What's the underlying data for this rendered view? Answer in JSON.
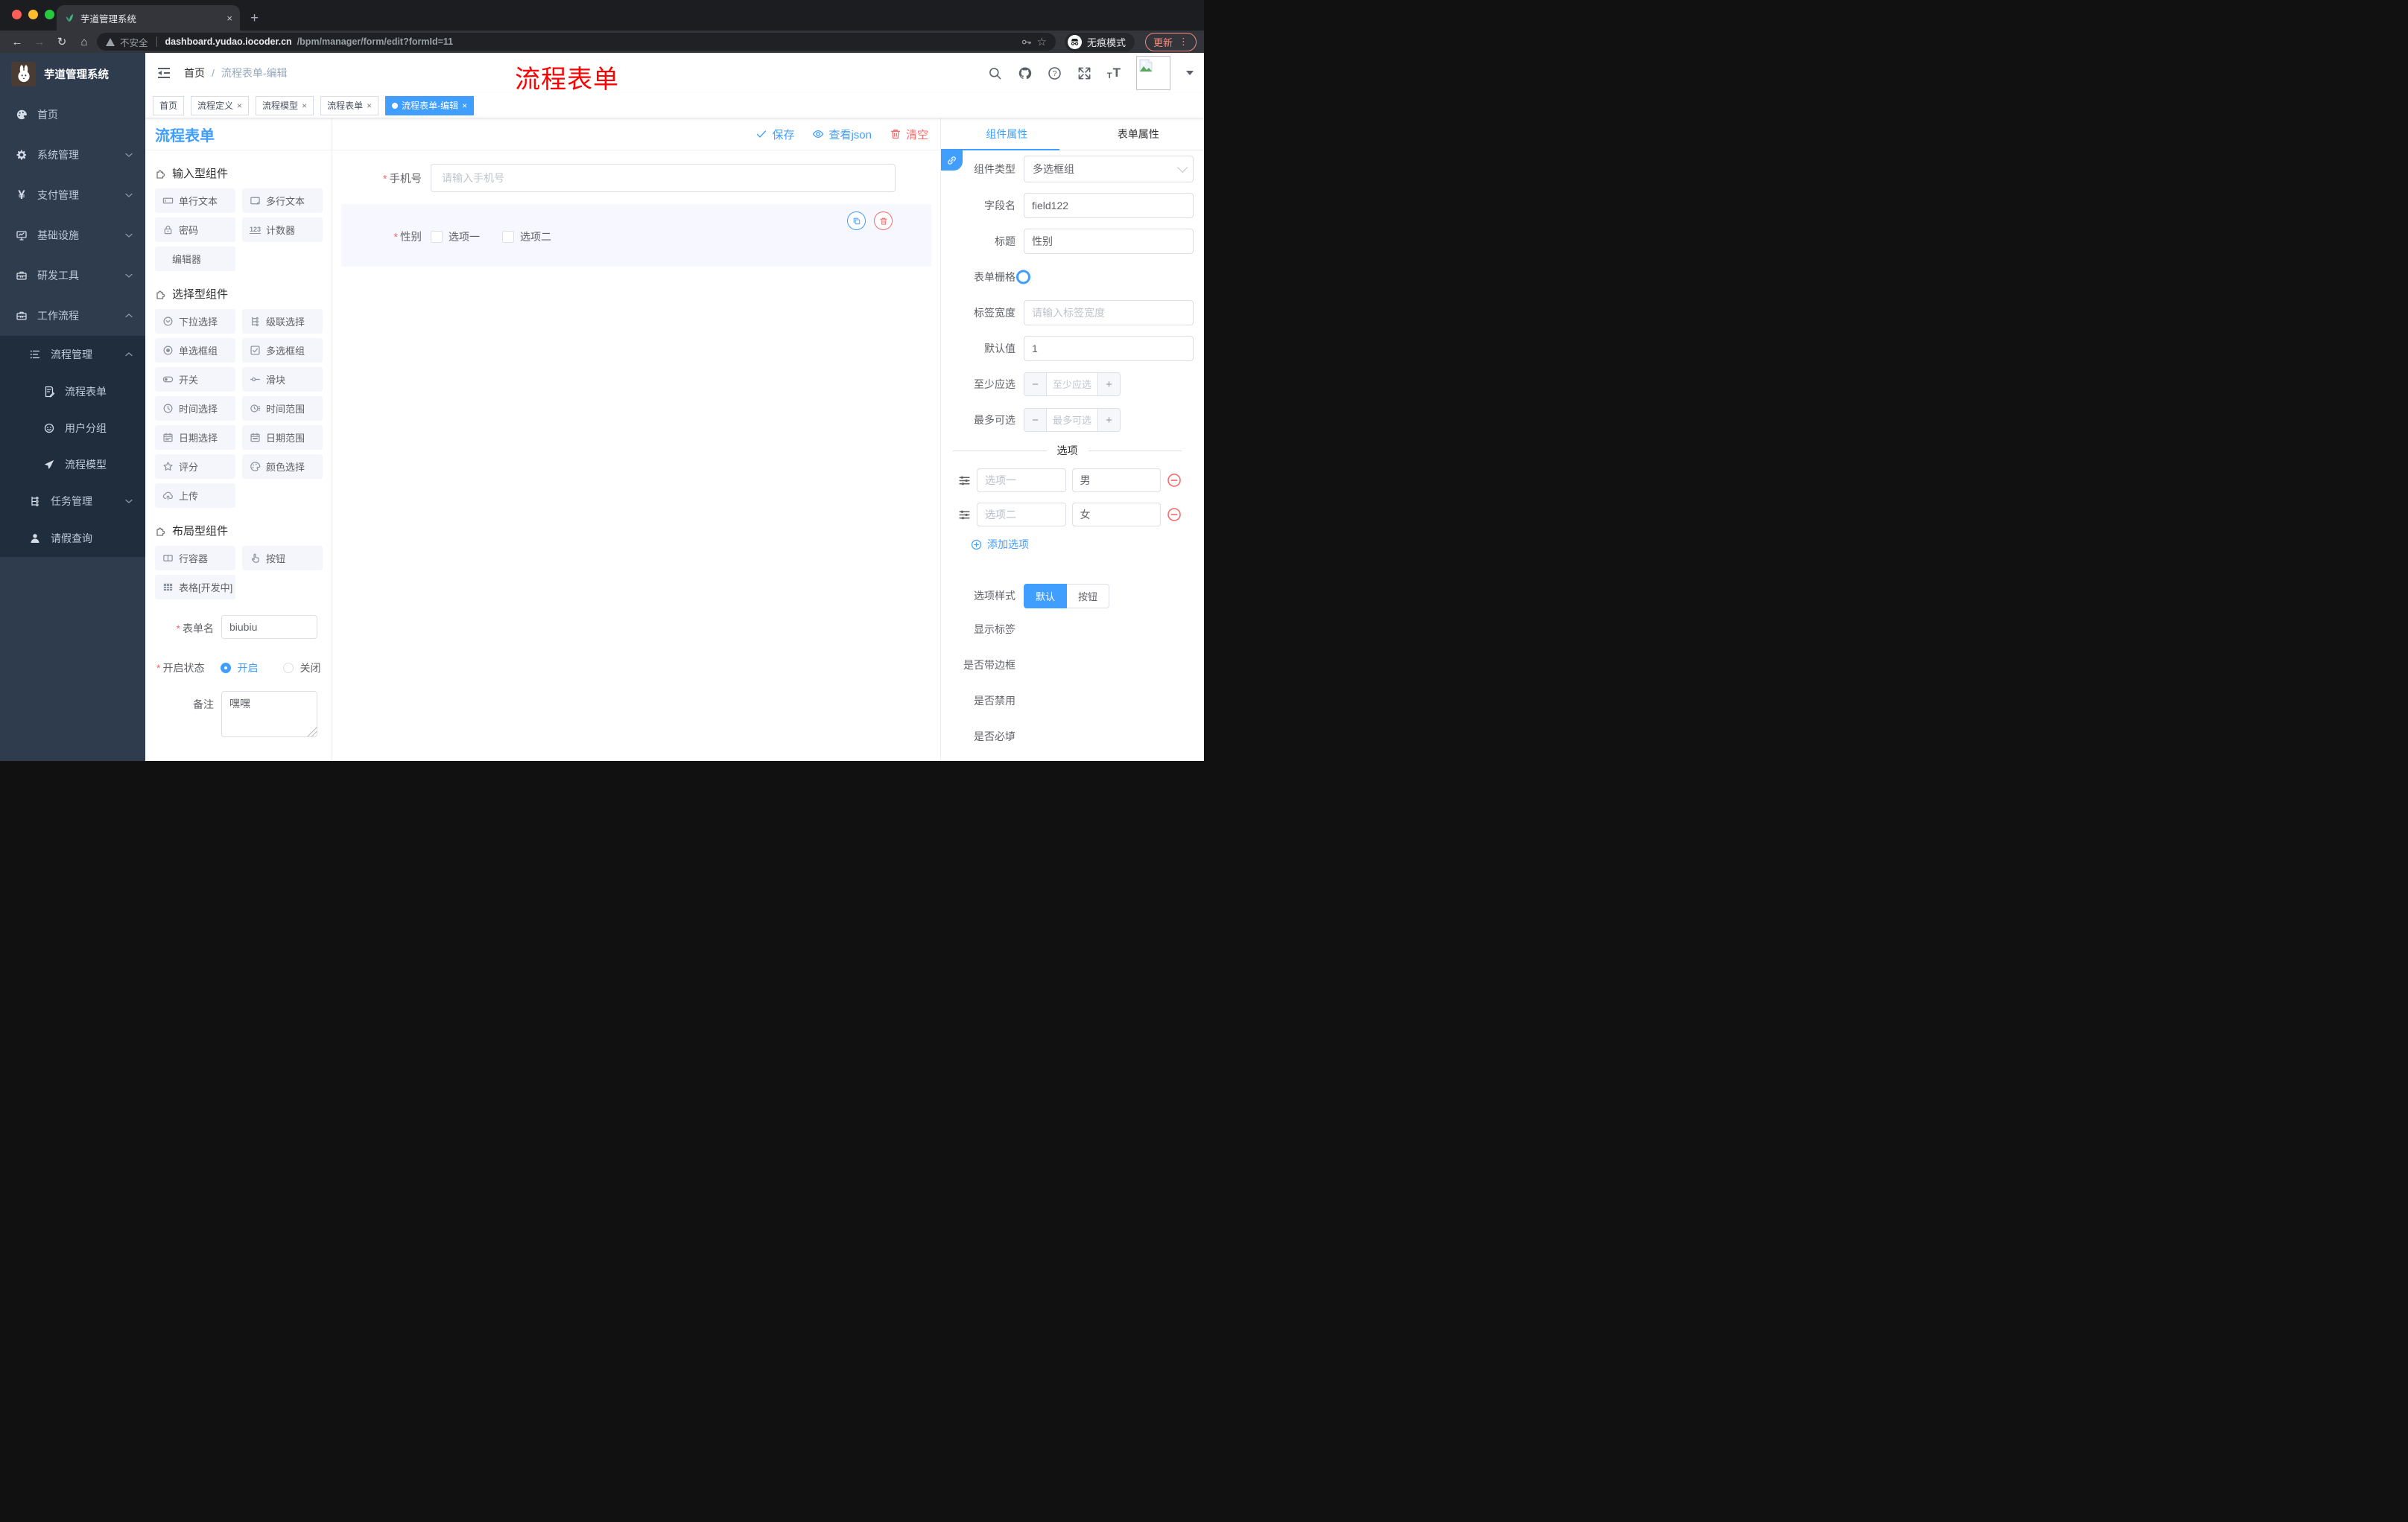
{
  "ui": {
    "required_mark": "*",
    "close_glyph": "×",
    "new_tab_glyph": "+",
    "kebab_glyph": "⋮",
    "breadcrumb_sep": "/",
    "question_glyph": "?",
    "counter_icon_text": "123",
    "textsize_letter_big": "T",
    "textsize_letter_small": "T",
    "back_glyph": "←",
    "forward_glyph": "→",
    "reload_glyph": "↻",
    "home_glyph": "⌂",
    "star_glyph": "☆",
    "minus_glyph": "−",
    "plus_glyph": "+"
  },
  "browser": {
    "tab_title": "芋道管理系统",
    "security_label": "不安全",
    "url_domain": "dashboard.yudao.iocoder.cn",
    "url_path": "/bpm/manager/form/edit?formId=11",
    "incognito_label": "无痕模式",
    "update_label": "更新"
  },
  "sidebar": {
    "logo_title": "芋道管理系统",
    "menu": [
      {
        "label": "首页"
      },
      {
        "label": "系统管理"
      },
      {
        "label": "支付管理"
      },
      {
        "label": "基础设施"
      },
      {
        "label": "研发工具"
      },
      {
        "label": "工作流程"
      }
    ],
    "workflow_submenu": {
      "process_management": "流程管理",
      "process_children": [
        {
          "label": "流程表单"
        },
        {
          "label": "用户分组"
        },
        {
          "label": "流程模型"
        }
      ],
      "task_management": "任务管理",
      "leave_query": "请假查询"
    }
  },
  "navbar": {
    "breadcrumb_home": "首页",
    "breadcrumb_current": "流程表单-编辑",
    "overlay_title": "流程表单"
  },
  "tags": {
    "items": [
      {
        "label": "首页",
        "active": false,
        "closable": false
      },
      {
        "label": "流程定义",
        "active": false,
        "closable": true
      },
      {
        "label": "流程模型",
        "active": false,
        "closable": true
      },
      {
        "label": "流程表单",
        "active": false,
        "closable": true
      },
      {
        "label": "流程表单-编辑",
        "active": true,
        "closable": true
      }
    ]
  },
  "designer": {
    "panel_title": "流程表单",
    "save_label": "保存",
    "view_json_label": "查看json",
    "clear_label": "清空"
  },
  "palette": {
    "sections": [
      {
        "title": "输入型组件",
        "items": [
          "单行文本",
          "多行文本",
          "密码",
          "计数器",
          "编辑器"
        ]
      },
      {
        "title": "选择型组件",
        "items": [
          "下拉选择",
          "级联选择",
          "单选框组",
          "多选框组",
          "开关",
          "滑块",
          "时间选择",
          "时间范围",
          "日期选择",
          "日期范围",
          "评分",
          "颜色选择",
          "上传"
        ]
      },
      {
        "title": "布局型组件",
        "items": [
          "行容器",
          "按钮",
          "表格[开发中]"
        ]
      }
    ]
  },
  "form_settings": {
    "name_label": "表单名",
    "name_value": "biubiu",
    "status_label": "开启状态",
    "status_on": "开启",
    "status_off": "关闭",
    "status_selected": "开启",
    "remark_label": "备注",
    "remark_value": "嘿嘿"
  },
  "canvas": {
    "phone_label": "手机号",
    "phone_placeholder": "请输入手机号",
    "gender_label": "性别",
    "gender_option1": "选项一",
    "gender_option2": "选项二"
  },
  "props": {
    "tab_component": "组件属性",
    "tab_form": "表单属性",
    "component_type_label": "组件类型",
    "component_type_value": "多选框组",
    "field_name_label": "字段名",
    "field_name_value": "field122",
    "title_label": "标题",
    "title_value": "性别",
    "grid_label": "表单栅格",
    "label_width_label": "标签宽度",
    "label_width_placeholder": "请输入标签宽度",
    "default_label": "默认值",
    "default_value": "1",
    "min_label": "至少应选",
    "min_placeholder": "至少应选",
    "max_label": "最多可选",
    "max_placeholder": "最多可选",
    "options_divider": "选项",
    "options": [
      {
        "label": "选项一",
        "value": "男"
      },
      {
        "label": "选项二",
        "value": "女"
      }
    ],
    "add_option_label": "添加选项",
    "style_label": "选项样式",
    "style_default": "默认",
    "style_button": "按钮",
    "style_selected": "默认",
    "switch_show_label": "显示标签",
    "switch_show_on": true,
    "switch_border_label": "是否带边框",
    "switch_border_on": false,
    "switch_disabled_label": "是否禁用",
    "switch_disabled_on": false,
    "switch_required_label": "是否必填",
    "switch_required_on": true
  },
  "colors": {
    "accent": "#409eff",
    "danger": "#f56c6c",
    "overlay_red": "#ff0000",
    "sidebar_bg": "#2f3c4e",
    "submenu_bg": "#1f2d3d"
  }
}
